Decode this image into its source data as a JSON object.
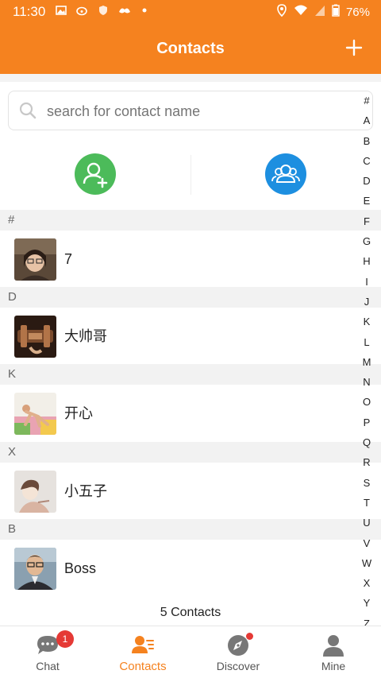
{
  "status_bar": {
    "time": "11:30",
    "battery": "76%",
    "left_icons": [
      "gallery-icon",
      "weibo-icon",
      "shield-icon",
      "game-icon",
      "dot-icon"
    ],
    "right_icons": [
      "location-icon",
      "wifi-icon",
      "signal-icon",
      "battery-icon"
    ]
  },
  "header": {
    "title": "Contacts",
    "plus_icon": "plus-icon"
  },
  "search": {
    "placeholder": "search for contact name"
  },
  "actions": {
    "add_friend_icon": "add-friend-icon",
    "group_icon": "group-icon",
    "add_color": "#4cbb5a",
    "group_color": "#1d8fe0"
  },
  "sections": [
    {
      "letter": "#",
      "contacts": [
        {
          "name": "7"
        }
      ]
    },
    {
      "letter": "D",
      "contacts": [
        {
          "name": "大帅哥"
        }
      ]
    },
    {
      "letter": "K",
      "contacts": [
        {
          "name": "开心"
        }
      ]
    },
    {
      "letter": "X",
      "contacts": [
        {
          "name": "小五子"
        }
      ]
    },
    {
      "letter": "B",
      "contacts": [
        {
          "name": "Boss"
        }
      ]
    }
  ],
  "contacts_count": "5  Contacts",
  "index_letters": [
    "#",
    "A",
    "B",
    "C",
    "D",
    "E",
    "F",
    "G",
    "H",
    "I",
    "J",
    "K",
    "L",
    "M",
    "N",
    "O",
    "P",
    "Q",
    "R",
    "S",
    "T",
    "U",
    "V",
    "W",
    "X",
    "Y",
    "Z"
  ],
  "tabs": [
    {
      "label": "Chat",
      "icon": "chat-icon",
      "badge": "1"
    },
    {
      "label": "Contacts",
      "icon": "contacts-icon",
      "active": true
    },
    {
      "label": "Discover",
      "icon": "discover-icon"
    },
    {
      "label": "Mine",
      "icon": "person-icon"
    }
  ],
  "colors": {
    "accent": "#f5821f",
    "badge": "#e53935"
  }
}
